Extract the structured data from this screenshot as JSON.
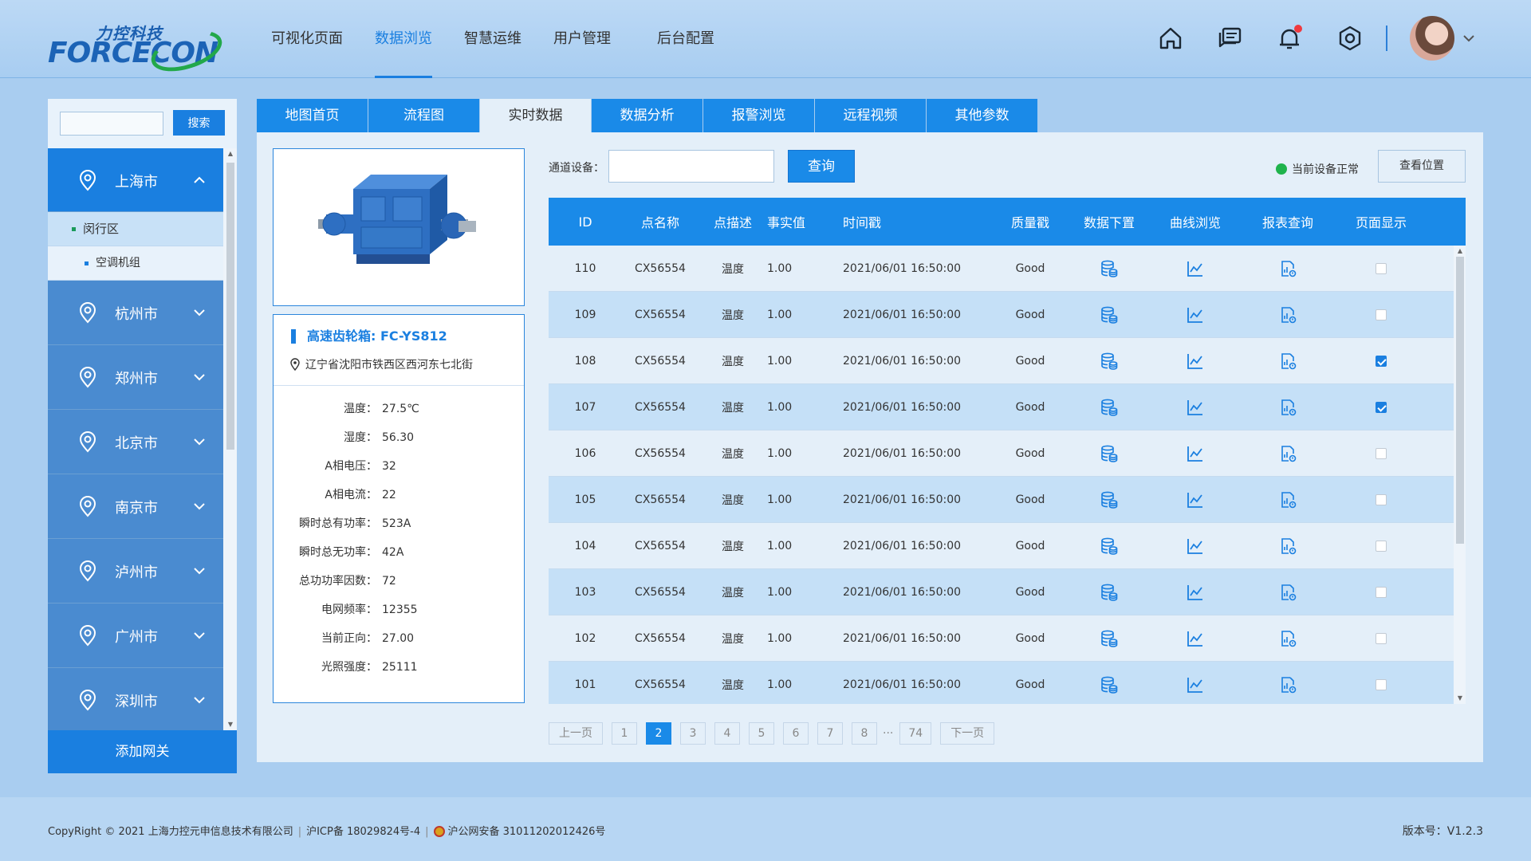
{
  "header": {
    "logo_cn": "力控科技",
    "logo_en": "FORCECON",
    "nav": [
      "可视化页面",
      "数据浏览",
      "智慧运维",
      "用户管理",
      "后台配置"
    ],
    "nav_active": 1,
    "icons": [
      "home-icon",
      "messages-icon",
      "bell-icon",
      "settings-icon"
    ],
    "has_notification": true
  },
  "sidebar": {
    "search_placeholder": "",
    "search_button": "搜索",
    "cities": [
      {
        "name": "上海市",
        "active": true,
        "expanded": true
      },
      {
        "name": "杭州市"
      },
      {
        "name": "郑州市"
      },
      {
        "name": "北京市"
      },
      {
        "name": "南京市"
      },
      {
        "name": "泸州市"
      },
      {
        "name": "广州市"
      },
      {
        "name": "深圳市"
      }
    ],
    "sub_items": [
      "闵行区",
      "空调机组"
    ],
    "add_gateway": "添加网关"
  },
  "tabs": [
    "地图首页",
    "流程图",
    "实时数据",
    "数据分析",
    "报警浏览",
    "远程视频",
    "其他参数"
  ],
  "tab_active": 2,
  "device": {
    "title": "高速齿轮箱: FC-YS812",
    "address": "辽宁省沈阳市铁西区西河东七北街",
    "rows": [
      {
        "label": "温度：",
        "value": "27.5℃"
      },
      {
        "label": "湿度：",
        "value": "56.30"
      },
      {
        "label": "A相电压：",
        "value": "32"
      },
      {
        "label": "A相电流：",
        "value": "22"
      },
      {
        "label": "瞬时总有功率：",
        "value": "523A"
      },
      {
        "label": "瞬时总无功率：",
        "value": "42A"
      },
      {
        "label": "总功功率因数：",
        "value": "72"
      },
      {
        "label": "电网频率：",
        "value": "12355"
      },
      {
        "label": "当前正向：",
        "value": "27.00"
      },
      {
        "label": "光照强度：",
        "value": "25111"
      }
    ]
  },
  "filter": {
    "label": "通道设备：",
    "value": "",
    "query_button": "查询",
    "status_text": "当前设备正常",
    "status_color": "#1fb34c",
    "location_button": "查看位置"
  },
  "table": {
    "headers": [
      "ID",
      "点名称",
      "点描述",
      "事实值",
      "时间戳",
      "质量戳",
      "数据下置",
      "曲线浏览",
      "报表查询",
      "页面显示"
    ],
    "rows": [
      {
        "id": "110",
        "name": "CX56554",
        "desc": "温度",
        "value": "1.00",
        "time": "2021/06/01 16:50:00",
        "quality": "Good",
        "checked": false
      },
      {
        "id": "109",
        "name": "CX56554",
        "desc": "温度",
        "value": "1.00",
        "time": "2021/06/01 16:50:00",
        "quality": "Good",
        "checked": false
      },
      {
        "id": "108",
        "name": "CX56554",
        "desc": "温度",
        "value": "1.00",
        "time": "2021/06/01 16:50:00",
        "quality": "Good",
        "checked": true
      },
      {
        "id": "107",
        "name": "CX56554",
        "desc": "温度",
        "value": "1.00",
        "time": "2021/06/01 16:50:00",
        "quality": "Good",
        "checked": true
      },
      {
        "id": "106",
        "name": "CX56554",
        "desc": "温度",
        "value": "1.00",
        "time": "2021/06/01 16:50:00",
        "quality": "Good",
        "checked": false
      },
      {
        "id": "105",
        "name": "CX56554",
        "desc": "温度",
        "value": "1.00",
        "time": "2021/06/01 16:50:00",
        "quality": "Good",
        "checked": false
      },
      {
        "id": "104",
        "name": "CX56554",
        "desc": "温度",
        "value": "1.00",
        "time": "2021/06/01 16:50:00",
        "quality": "Good",
        "checked": false
      },
      {
        "id": "103",
        "name": "CX56554",
        "desc": "温度",
        "value": "1.00",
        "time": "2021/06/01 16:50:00",
        "quality": "Good",
        "checked": false
      },
      {
        "id": "102",
        "name": "CX56554",
        "desc": "温度",
        "value": "1.00",
        "time": "2021/06/01 16:50:00",
        "quality": "Good",
        "checked": false
      },
      {
        "id": "101",
        "name": "CX56554",
        "desc": "温度",
        "value": "1.00",
        "time": "2021/06/01 16:50:00",
        "quality": "Good",
        "checked": false
      }
    ]
  },
  "pager": {
    "prev": "上一页",
    "pages": [
      "1",
      "2",
      "3",
      "4",
      "5",
      "6",
      "7",
      "8"
    ],
    "ellipsis": "···",
    "last": "74",
    "current": "2",
    "next": "下一页"
  },
  "footer": {
    "copyright": "CopyRight © 2021 上海力控元申信息技术有限公司",
    "icp": "沪ICP备 18029824号-4",
    "police": "沪公网安备 31011202012426号",
    "version": "版本号：V1.2.3"
  },
  "colors": {
    "primary": "#1a7fe0",
    "header_bg": "#bcd9f5",
    "row_alt": "#c5e0f7"
  }
}
